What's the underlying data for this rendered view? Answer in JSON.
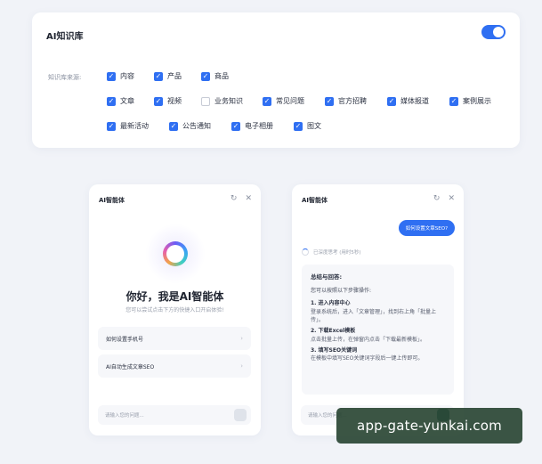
{
  "kb": {
    "title": "AI知识库",
    "toggle_on": true,
    "source_label": "知识库来源:",
    "options": [
      {
        "label": "内容",
        "checked": true
      },
      {
        "label": "产品",
        "checked": true
      },
      {
        "label": "商品",
        "checked": true
      },
      {
        "label": "文章",
        "checked": true
      },
      {
        "label": "视频",
        "checked": true
      },
      {
        "label": "业务知识",
        "checked": false
      },
      {
        "label": "常见问题",
        "checked": true
      },
      {
        "label": "官方招聘",
        "checked": true
      },
      {
        "label": "媒体报道",
        "checked": true
      },
      {
        "label": "案例展示",
        "checked": true
      },
      {
        "label": "最新活动",
        "checked": true
      },
      {
        "label": "公告通知",
        "checked": true
      },
      {
        "label": "电子相册",
        "checked": true
      },
      {
        "label": "图文",
        "checked": true
      }
    ]
  },
  "left_panel": {
    "title": "AI智能体",
    "greeting": "你好，我是AI智能体",
    "greeting_sub": "您可以尝试点击下方的快捷入口开启体验!",
    "suggestions": [
      "如何设置手机号",
      "AI自动生成文章SEO"
    ],
    "input_placeholder": "请输入您的问题..."
  },
  "right_panel": {
    "title": "AI智能体",
    "user_question": "如何设置文章SEO?",
    "thinking": "已深度思考 (用时5秒)",
    "answer_heading": "总结与回答:",
    "answer_intro": "您可以按照以下步骤操作:",
    "steps": [
      {
        "title": "1. 进入内容中心",
        "desc": "登录系统后，进入「文章管理」，找到右上角「批量上传」。"
      },
      {
        "title": "2. 下载Excel模板",
        "desc": "点击批量上传，在弹窗内点击「下载最新模板」。"
      },
      {
        "title": "3. 填写SEO关键词",
        "desc": "在模板中填写SEO关键词字段后一键上传即可。"
      }
    ],
    "input_placeholder": "请输入您的问题..."
  },
  "watermark": "app-gate-yunkai.com",
  "colors": {
    "accent": "#2f6ff2",
    "background": "#f1f3f8",
    "watermark_bg": "#2a4634"
  },
  "icons": {
    "refresh": "refresh-icon",
    "close": "close-icon",
    "check": "check-icon",
    "send": "send-icon",
    "arrow": "chevron-right-icon"
  }
}
